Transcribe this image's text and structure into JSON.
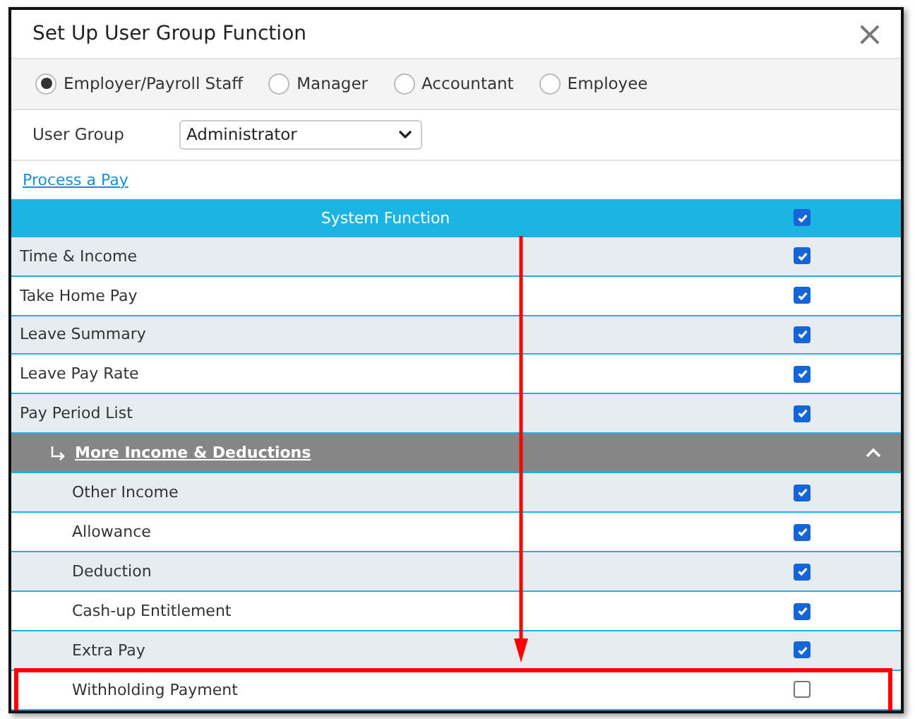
{
  "dialog": {
    "title": "Set Up User Group Function",
    "close": "×"
  },
  "roles": [
    {
      "label": "Employer/Payroll Staff",
      "selected": true
    },
    {
      "label": "Manager",
      "selected": false
    },
    {
      "label": "Accountant",
      "selected": false
    },
    {
      "label": "Employee",
      "selected": false
    }
  ],
  "user_group": {
    "label": "User Group",
    "value": "Administrator"
  },
  "link": "Process a Pay",
  "table": {
    "header": {
      "label": "System Function",
      "checked": true
    },
    "rows": [
      {
        "kind": "item",
        "label": "Time & Income",
        "checked": true,
        "highlighted": false
      },
      {
        "kind": "item",
        "label": "Take Home Pay",
        "checked": true,
        "highlighted": false
      },
      {
        "kind": "item",
        "label": "Leave Summary",
        "checked": true,
        "highlighted": false
      },
      {
        "kind": "item",
        "label": "Leave Pay Rate",
        "checked": true,
        "highlighted": false
      },
      {
        "kind": "item",
        "label": "Pay Period List",
        "checked": true,
        "highlighted": false
      },
      {
        "kind": "group",
        "label": "More Income & Deductions",
        "expanded": true,
        "children": [
          {
            "label": "Other Income",
            "checked": true,
            "highlighted": false
          },
          {
            "label": "Allowance",
            "checked": true,
            "highlighted": false
          },
          {
            "label": "Deduction",
            "checked": true,
            "highlighted": false
          },
          {
            "label": "Cash-up Entitlement",
            "checked": true,
            "highlighted": false
          },
          {
            "label": "Extra Pay",
            "checked": true,
            "highlighted": false
          },
          {
            "label": "Withholding Payment",
            "checked": false,
            "highlighted": true
          }
        ]
      }
    ]
  }
}
